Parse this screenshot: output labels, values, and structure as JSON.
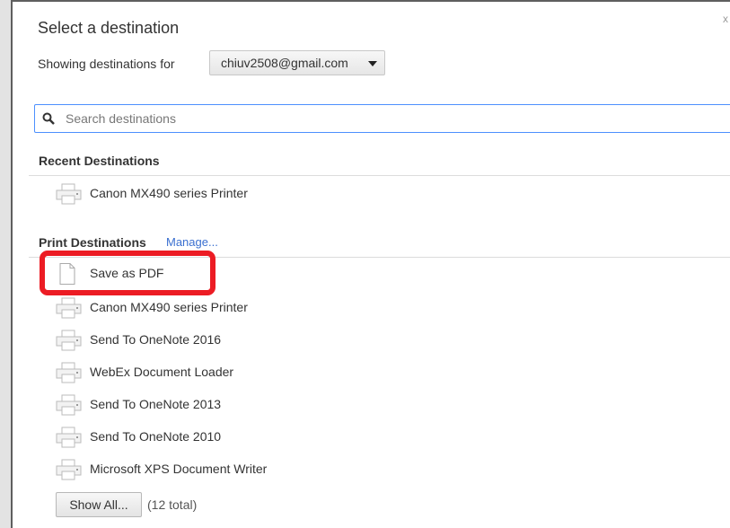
{
  "dialog": {
    "title": "Select a destination",
    "close_glyph": "x",
    "showing_label": "Showing destinations for",
    "account": "chiuv2508@gmail.com",
    "search_placeholder": "Search destinations"
  },
  "recent": {
    "header": "Recent Destinations",
    "items": [
      {
        "label": "Canon MX490 series Printer",
        "icon": "printer-icon"
      }
    ]
  },
  "print_destinations": {
    "header": "Print Destinations",
    "manage_link": "Manage...",
    "items": [
      {
        "label": "Save as PDF",
        "icon": "document-icon"
      },
      {
        "label": "Canon MX490 series Printer",
        "icon": "printer-icon"
      },
      {
        "label": "Send To OneNote 2016",
        "icon": "printer-icon"
      },
      {
        "label": "WebEx Document Loader",
        "icon": "printer-icon"
      },
      {
        "label": "Send To OneNote 2013",
        "icon": "printer-icon"
      },
      {
        "label": "Send To OneNote 2010",
        "icon": "printer-icon"
      },
      {
        "label": "Microsoft XPS Document Writer",
        "icon": "printer-icon"
      }
    ],
    "show_all_label": "Show All...",
    "total_label": "(12 total)"
  },
  "colors": {
    "highlight": "#ec1c24",
    "link": "#3a6fd0",
    "focus_border": "#4d90fe"
  }
}
